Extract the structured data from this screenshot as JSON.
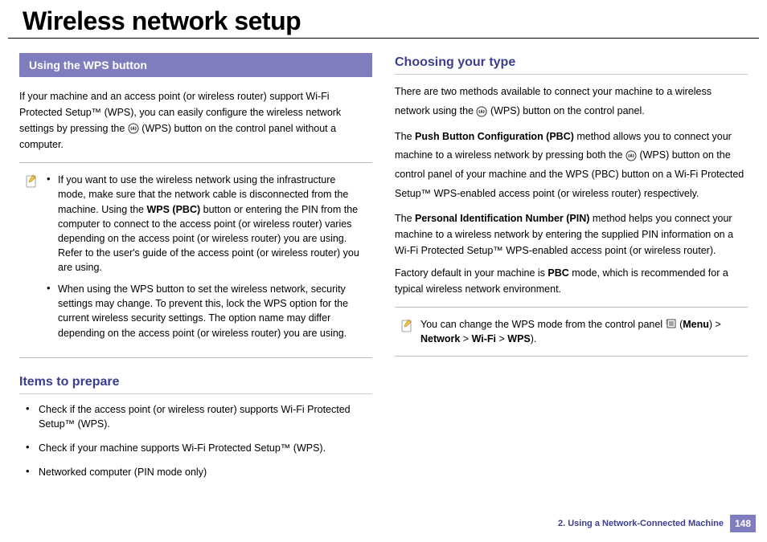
{
  "title": "Wireless network setup",
  "left": {
    "bar": "Using the WPS button",
    "intro_parts": [
      "If your machine and an access point (or wireless router) support Wi-Fi Protected Setup™ (WPS), you can easily configure the wireless network settings by pressing the ",
      " (WPS) button on the control panel without a computer."
    ],
    "note1_a_prefix": "If you want to use the wireless network using the infrastructure mode, make sure that the network cable is disconnected from the machine. Using the ",
    "note1_a_bold": "WPS (PBC)",
    "note1_a_suffix": " button or entering the PIN from the computer to connect to the access point (or wireless router) varies depending on the access point (or wireless router) you are using. Refer to the user's guide of the access point (or wireless router) you are using.",
    "note1_b": "When using the WPS button to set the wireless network, security settings may change. To prevent this, lock the WPS option for the current wireless security settings. The option name may differ depending on the access point (or wireless router) you are using.",
    "items_heading": "Items to prepare",
    "items": [
      "Check if the access point (or wireless router) supports Wi-Fi Protected Setup™ (WPS).",
      "Check if your machine supports Wi-Fi Protected Setup™ (WPS).",
      "Networked computer (PIN mode only)"
    ]
  },
  "right": {
    "heading": "Choosing your type",
    "p1_a": "There are two methods available to connect your machine to a wireless network using the ",
    "p1_b": " (WPS) button on the control panel.",
    "p2_a": "The ",
    "p2_bold": "Push Button Configuration (PBC)",
    "p2_b": " method allows you to connect your machine to a wireless network by pressing both the ",
    "p2_c": " (WPS) button on the control panel of your machine and the WPS (PBC) button on a Wi-Fi Protected Setup™ WPS-enabled access point (or wireless router) respectively.",
    "p3_a": "The ",
    "p3_bold": "Personal Identification Number (PIN)",
    "p3_b": " method helps you connect your machine to a wireless network by entering the supplied PIN information on a Wi-Fi Protected Setup™ WPS-enabled access point (or wireless router).",
    "p4_a": "Factory default in your machine is ",
    "p4_bold": "PBC",
    "p4_b": " mode, which is recommended for a typical wireless network environment.",
    "note_a": "You can change the WPS mode from the control panel ",
    "note_b1": " (",
    "note_menu": "Menu",
    "note_b2": ") > ",
    "note_net": "Network",
    "note_gt": " > ",
    "note_wifi": "Wi-Fi",
    "note_gt2": " > ",
    "note_wps": "WPS",
    "note_end": ")."
  },
  "footer": {
    "chapter": "2.  Using a Network-Connected Machine",
    "page": "148"
  }
}
